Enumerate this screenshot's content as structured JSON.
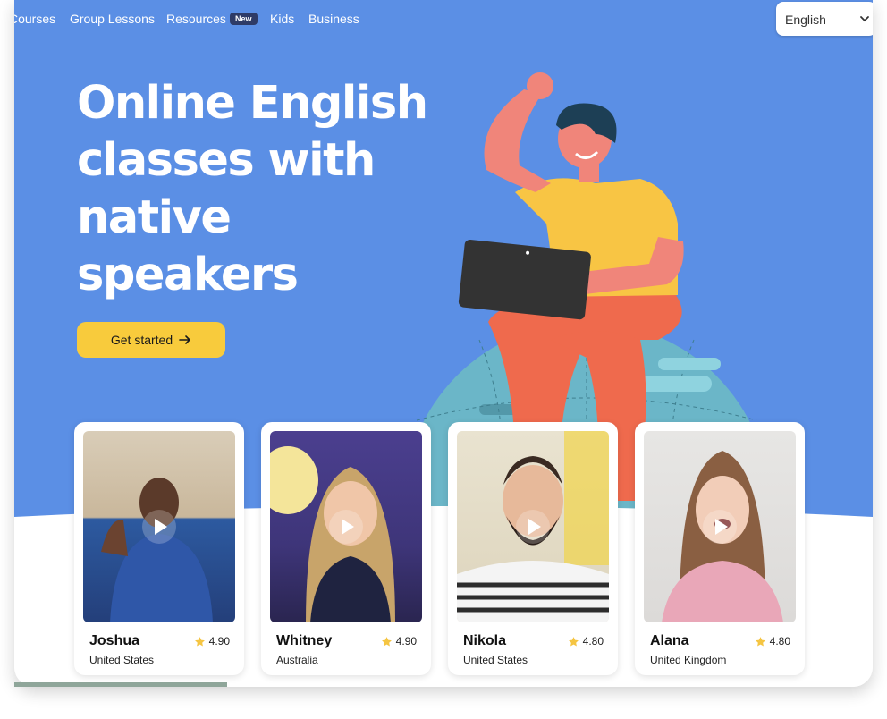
{
  "nav": {
    "items": [
      "Courses",
      "Group Lessons",
      "Resources",
      "Kids",
      "Business"
    ],
    "resources_badge": "New",
    "language": "English"
  },
  "hero": {
    "headline": "Online English classes with native speakers",
    "cta_label": "Get started"
  },
  "teachers": [
    {
      "name": "Joshua",
      "country": "United States",
      "rating": "4.90"
    },
    {
      "name": "Whitney",
      "country": "Australia",
      "rating": "4.90"
    },
    {
      "name": "Nikola",
      "country": "United States",
      "rating": "4.80"
    },
    {
      "name": "Alana",
      "country": "United Kingdom",
      "rating": "4.80"
    }
  ],
  "colors": {
    "hero_bg": "#5b8fe5",
    "cta": "#f8cb3c",
    "badge": "#2e3b67",
    "star": "#f5c542"
  },
  "icons": [
    "chevron-down-icon",
    "arrow-right-icon",
    "play-icon",
    "star-icon"
  ]
}
